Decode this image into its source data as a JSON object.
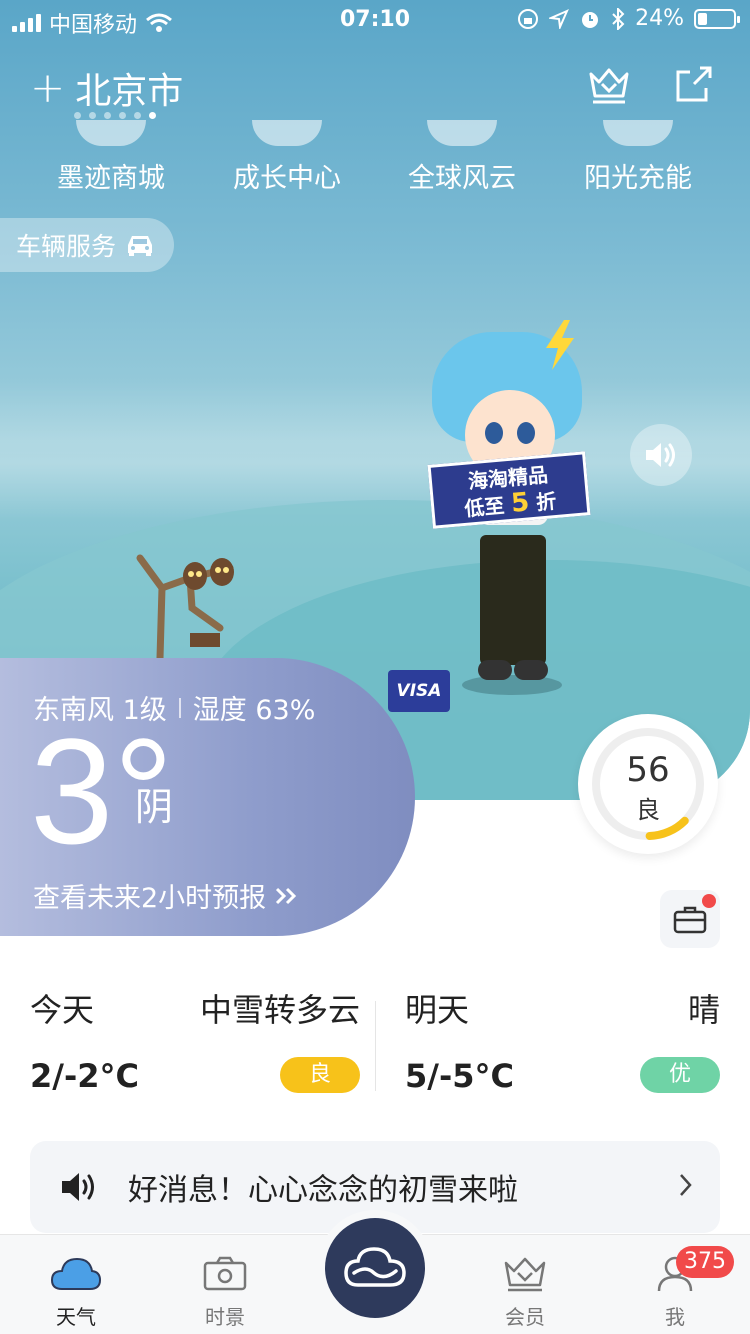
{
  "status_bar": {
    "carrier": "中国移动",
    "time": "07:10",
    "battery_percent": "24%"
  },
  "header": {
    "city": "北京市",
    "add_symbol": "+",
    "page_count": 6,
    "active_page_index": 5
  },
  "quick_links": [
    {
      "label": "墨迹商城"
    },
    {
      "label": "成长中心"
    },
    {
      "label": "全球风云"
    },
    {
      "label": "阳光充能"
    }
  ],
  "vehicle_service": {
    "label": "车辆服务"
  },
  "promo_sign": {
    "line1": "海淘精品",
    "line2_prefix": "低至",
    "line2_number": "5",
    "line2_suffix": "折"
  },
  "visa_card": {
    "label": "VISA"
  },
  "current": {
    "wind": "东南风 1级",
    "humidity": "湿度 63%",
    "temperature": "3°",
    "condition": "阴",
    "forecast_link": "查看未来2小时预报"
  },
  "aqi": {
    "value": "56",
    "label": "良",
    "fraction": 0.12,
    "color": "#f7c21a"
  },
  "days": [
    {
      "name": "今天",
      "condition": "中雪转多云",
      "temp": "2/-2°C",
      "aqi_label": "良",
      "aqi_color": "#f7c21a"
    },
    {
      "name": "明天",
      "condition": "晴",
      "temp": "5/-5°C",
      "aqi_label": "优",
      "aqi_color": "#6fd3a6"
    }
  ],
  "news": {
    "text": "好消息！心心念念的初雪来啦"
  },
  "tabbar": {
    "items": [
      {
        "label": "天气",
        "icon": "cloud-icon",
        "active": true
      },
      {
        "label": "时景",
        "icon": "camera-icon"
      },
      {
        "label": "",
        "icon": "moji-logo-icon"
      },
      {
        "label": "会员",
        "icon": "crown-icon"
      },
      {
        "label": "我",
        "icon": "user-icon"
      }
    ],
    "me_badge": "375"
  },
  "colors": {
    "panel": "#8f9dcc",
    "active_tab": "#4b9fe6"
  }
}
